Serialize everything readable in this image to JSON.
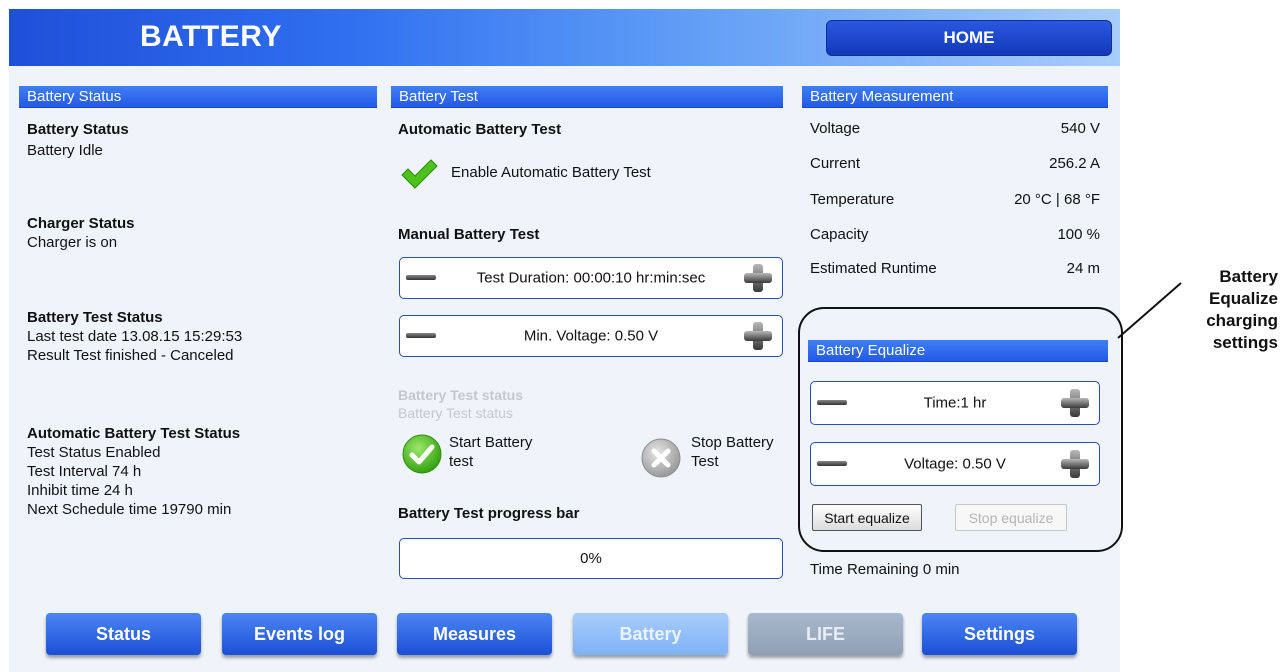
{
  "header": {
    "title": "BATTERY",
    "home_label": "HOME"
  },
  "battery_status": {
    "panel_title": "Battery Status",
    "status_heading": "Battery Status",
    "status_value": "Battery Idle",
    "charger_heading": "Charger Status",
    "charger_value": "Charger is on",
    "test_status_heading": "Battery Test Status",
    "last_test": "Last test date 13.08.15 15:29:53",
    "result": "Result Test finished - Canceled",
    "auto_heading": "Automatic Battery Test Status",
    "auto_lines": [
      "Test Status Enabled",
      "Test Interval 74 h",
      "Inhibit time 24 h",
      "Next Schedule time 19790 min"
    ]
  },
  "battery_test": {
    "panel_title": "Battery Test",
    "auto_heading": "Automatic Battery Test",
    "enable_label": "Enable Automatic Battery Test",
    "manual_heading": "Manual Battery Test",
    "duration_label": "Test Duration: 00:00:10 hr:min:sec",
    "min_voltage_label": "Min. Voltage: 0.50 V",
    "status_line1": "Battery Test status",
    "status_line2": "Battery Test status",
    "start_line1": "Start Battery",
    "start_line2": "test",
    "stop_line1": "Stop Battery",
    "stop_line2": "Test",
    "progress_heading": "Battery Test progress bar",
    "progress_value": "0%"
  },
  "measurement": {
    "panel_title": "Battery Measurement",
    "rows": [
      {
        "label": "Voltage",
        "value": "540 V"
      },
      {
        "label": "Current",
        "value": "256.2 A"
      },
      {
        "label": "Temperature",
        "value": "20 °C | 68 °F"
      },
      {
        "label": "Capacity",
        "value": "100 %"
      },
      {
        "label": "Estimated Runtime",
        "value": "24 m"
      }
    ]
  },
  "equalize": {
    "panel_title": "Battery Equalize",
    "time_label": "Time:1 hr",
    "voltage_label": "Voltage: 0.50 V",
    "start_label": "Start equalize",
    "stop_label": "Stop equalize",
    "remaining": "Time Remaining 0 min"
  },
  "annotation": {
    "line1": "Battery",
    "line2": "Equalize",
    "line3": "charging",
    "line4": "settings"
  },
  "nav": [
    "Status",
    "Events log",
    "Measures",
    "Battery",
    "LIFE",
    "Settings"
  ],
  "colors": {
    "accent": "#2459e6",
    "header_start": "#1f4fd8",
    "header_end": "#a9cdfa",
    "check_green": "#4cc21a"
  }
}
